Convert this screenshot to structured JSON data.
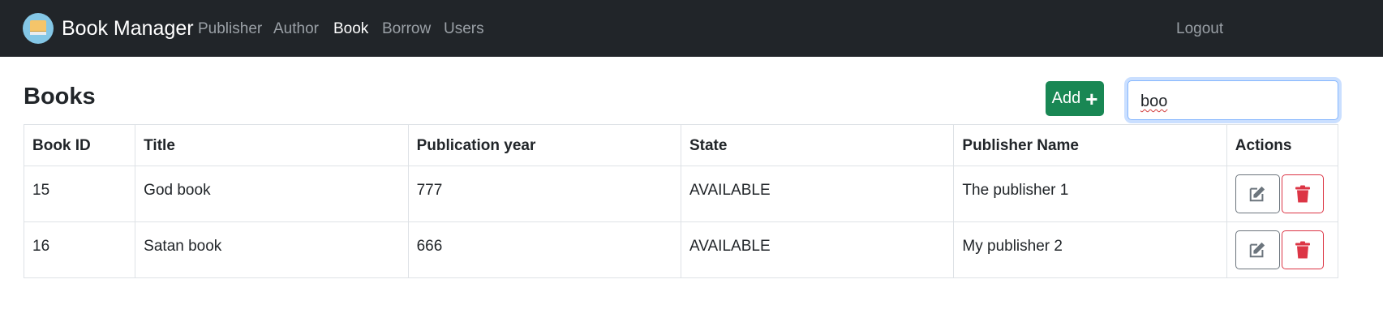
{
  "navbar": {
    "brand": "Book Manager",
    "links": [
      {
        "label": "Publisher",
        "active": false
      },
      {
        "label": "Author",
        "active": false
      },
      {
        "label": "Book",
        "active": true
      },
      {
        "label": "Borrow",
        "active": false
      },
      {
        "label": "Users",
        "active": false
      }
    ],
    "logout": "Logout",
    "logo_icon": "book-icon"
  },
  "page": {
    "title": "Books",
    "add_label": "Add",
    "search_value": "boo"
  },
  "table": {
    "columns": [
      "Book ID",
      "Title",
      "Publication year",
      "State",
      "Publisher Name",
      "Actions"
    ],
    "rows": [
      {
        "id": "15",
        "title": "God book",
        "year": "777",
        "state": "AVAILABLE",
        "publisher": "The publisher 1"
      },
      {
        "id": "16",
        "title": "Satan book",
        "year": "666",
        "state": "AVAILABLE",
        "publisher": "My publisher 2"
      }
    ]
  },
  "colors": {
    "navbar": "#212529",
    "add_button": "#198754",
    "delete": "#dc3545",
    "edit": "#6c757d"
  }
}
